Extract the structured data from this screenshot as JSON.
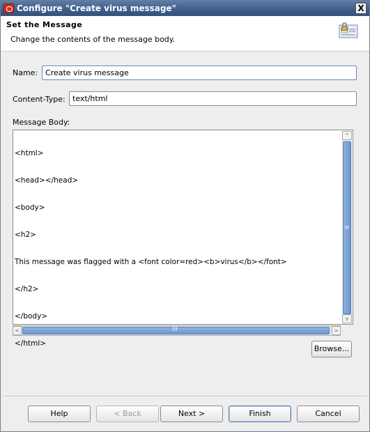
{
  "window": {
    "title": "Configure \"Create virus message\"",
    "close_glyph": "X"
  },
  "banner": {
    "title": "Set the Message",
    "subtitle": "Change the contents of the message body.",
    "icon": "message-config-icon"
  },
  "form": {
    "name_label": "Name:",
    "name_value": "Create virus message",
    "content_type_label": "Content-Type:",
    "content_type_value": "text/html",
    "message_body_label": "Message Body:",
    "message_body_lines": [
      "<html>",
      "<head></head>",
      "<body>",
      "<h2>",
      "This message was flagged with a <font color=red><b>virus</b></font>",
      "</h2>",
      "</body>",
      "</html>"
    ],
    "browse_label": "Browse..."
  },
  "scrollbars": {
    "up": "^",
    "down": "v",
    "left": "<",
    "right": ">",
    "vgrip": "≡",
    "hgrip": "III"
  },
  "footer": {
    "help": "Help",
    "back": "< Back",
    "next": "Next >",
    "finish": "Finish",
    "cancel": "Cancel"
  }
}
